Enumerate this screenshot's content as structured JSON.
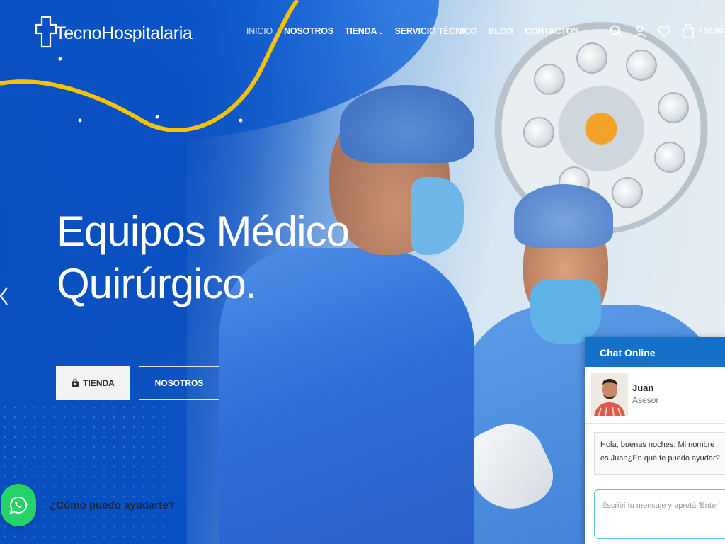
{
  "header": {
    "logo_text": "TecnoHospitalaria",
    "nav": [
      {
        "label": "INICIO"
      },
      {
        "label": "NOSOTROS"
      },
      {
        "label": "TIENDA"
      },
      {
        "label": "SERVICIO TÉCNICO"
      },
      {
        "label": "BLOG"
      },
      {
        "label": "CONTACTOS"
      }
    ],
    "cart_total": "/ $0,00"
  },
  "hero": {
    "title": "Equipos Médico\nQuirúrgico.",
    "buttons": {
      "tienda": "TIENDA",
      "nosotros": "NOSOTROS"
    }
  },
  "whatsapp": {
    "label": "¿Cómo puedo ayudarte?"
  },
  "chat": {
    "title": "Chat Online",
    "agent_name": "Juan",
    "agent_role": "Asesor",
    "message": "Hola, buenas noches. Mi nombre es Juan¿En qué te puedo ayudar?",
    "input_placeholder": "Escribí tu mensaje y apretá 'Enter'"
  },
  "colors": {
    "hero_blue": "#0a4fc0",
    "accent_yellow": "#f5c400",
    "chat_header": "#1571c7",
    "whatsapp_green": "#25d366"
  }
}
